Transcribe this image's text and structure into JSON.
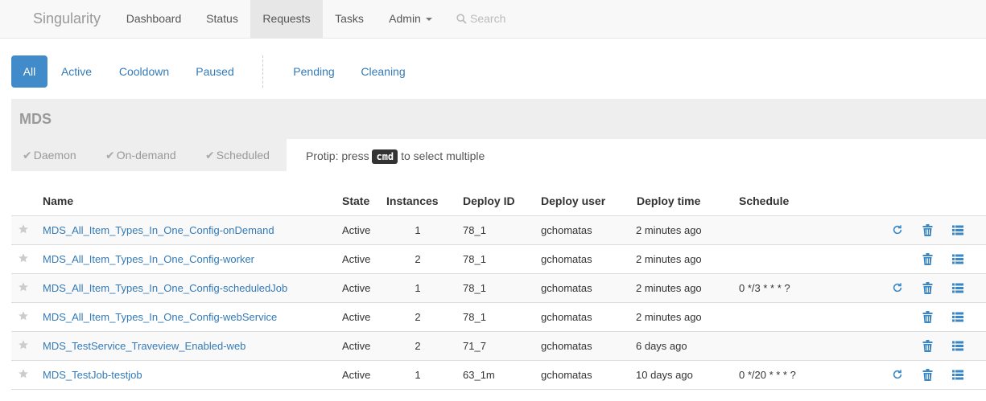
{
  "navbar": {
    "brand": "Singularity",
    "items": [
      {
        "label": "Dashboard"
      },
      {
        "label": "Status"
      },
      {
        "label": "Requests",
        "active": true
      },
      {
        "label": "Tasks"
      },
      {
        "label": "Admin"
      }
    ],
    "search_label": "Search"
  },
  "filters": {
    "pills": [
      {
        "label": "All",
        "active": true
      },
      {
        "label": "Active"
      },
      {
        "label": "Cooldown"
      },
      {
        "label": "Paused"
      },
      {
        "label": "Pending"
      },
      {
        "label": "Cleaning"
      }
    ]
  },
  "group": {
    "title": "MDS",
    "types": [
      {
        "label": "Daemon"
      },
      {
        "label": "On-demand"
      },
      {
        "label": "Scheduled"
      }
    ],
    "protip_before": "Protip: press",
    "protip_key": "cmd",
    "protip_after": "to select multiple"
  },
  "table": {
    "headers": [
      "Name",
      "State",
      "Instances",
      "Deploy ID",
      "Deploy user",
      "Deploy time",
      "Schedule"
    ],
    "rows": [
      {
        "name": "MDS_All_Item_Types_In_One_Config-onDemand",
        "state": "Active",
        "instances": "1",
        "deploy_id": "78_1",
        "deploy_user": "gchomatas",
        "deploy_time": "2 minutes ago",
        "schedule": "",
        "can_run": true
      },
      {
        "name": "MDS_All_Item_Types_In_One_Config-worker",
        "state": "Active",
        "instances": "2",
        "deploy_id": "78_1",
        "deploy_user": "gchomatas",
        "deploy_time": "2 minutes ago",
        "schedule": "",
        "can_run": false
      },
      {
        "name": "MDS_All_Item_Types_In_One_Config-scheduledJob",
        "state": "Active",
        "instances": "1",
        "deploy_id": "78_1",
        "deploy_user": "gchomatas",
        "deploy_time": "2 minutes ago",
        "schedule": "0 */3 * * * ?",
        "can_run": true
      },
      {
        "name": "MDS_All_Item_Types_In_One_Config-webService",
        "state": "Active",
        "instances": "2",
        "deploy_id": "78_1",
        "deploy_user": "gchomatas",
        "deploy_time": "2 minutes ago",
        "schedule": "",
        "can_run": false
      },
      {
        "name": "MDS_TestService_Traveview_Enabled-web",
        "state": "Active",
        "instances": "2",
        "deploy_id": "71_7",
        "deploy_user": "gchomatas",
        "deploy_time": "6 days ago",
        "schedule": "",
        "can_run": false
      },
      {
        "name": "MDS_TestJob-testjob",
        "state": "Active",
        "instances": "1",
        "deploy_id": "63_1m",
        "deploy_user": "gchomatas",
        "deploy_time": "10 days ago",
        "schedule": "0 */20 * * * ?",
        "can_run": true
      }
    ]
  },
  "icons": {
    "star": "star-icon",
    "run": "refresh-icon",
    "delete": "trash-icon",
    "details": "list-icon",
    "search": "search-icon",
    "check": "check-icon"
  },
  "colors": {
    "link": "#337ab7",
    "active_pill": "#428bca",
    "action_icon": "#3a87c8"
  }
}
